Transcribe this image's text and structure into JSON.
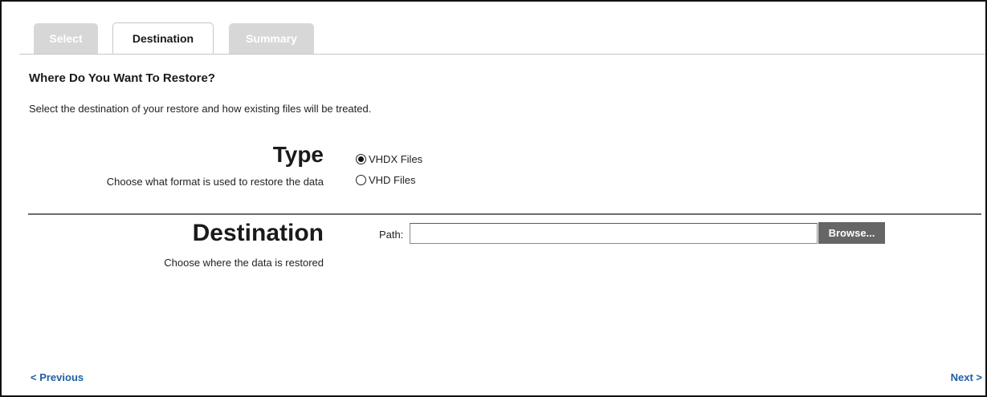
{
  "tabs": [
    {
      "label": "Select",
      "state": "inactive"
    },
    {
      "label": "Destination",
      "state": "active"
    },
    {
      "label": "Summary",
      "state": "inactive"
    }
  ],
  "heading": "Where Do You Want To Restore?",
  "intro": "Select the destination of your restore and how existing files will be treated.",
  "type_section": {
    "title": "Type",
    "description": "Choose what format is used to restore the data",
    "options": [
      {
        "label": "VHDX Files",
        "selected": true
      },
      {
        "label": "VHD Files",
        "selected": false
      }
    ]
  },
  "destination_section": {
    "title": "Destination",
    "description": "Choose where the data is restored",
    "path_label": "Path:",
    "path_value": "",
    "browse_label": "Browse..."
  },
  "navigation": {
    "previous_label": "< Previous",
    "next_label": "Next >"
  },
  "colors": {
    "link": "#1f5fa3",
    "browse_button": "#666666",
    "inactive_tab": "#d7d7d7"
  }
}
